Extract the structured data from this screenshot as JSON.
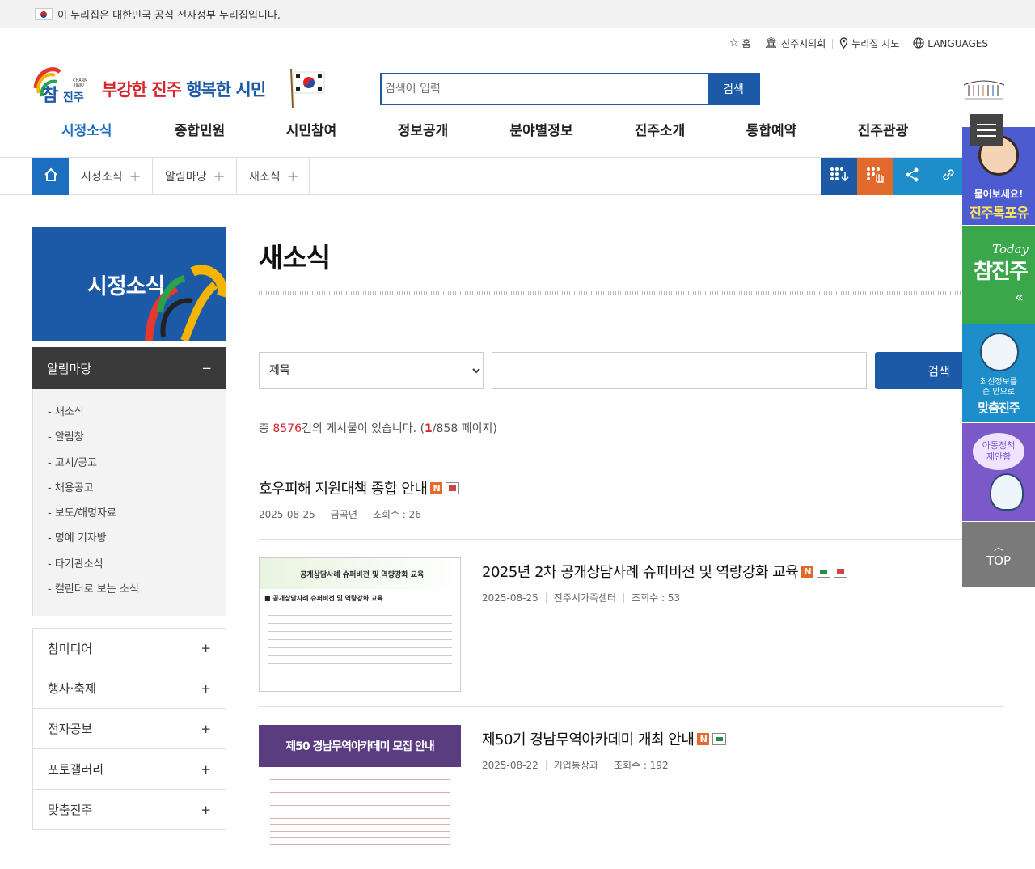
{
  "gov_banner": {
    "text": "이 누리집은 대한민국 공식 전자정부 누리집입니다."
  },
  "util_nav": [
    {
      "label": "홈",
      "icon": "star-icon"
    },
    {
      "label": "진주시의회",
      "icon": "council-icon"
    },
    {
      "label": "누리집 지도",
      "icon": "location-pin-icon"
    },
    {
      "label": "LANGUAGES",
      "icon": "globe-icon"
    }
  ],
  "header": {
    "slogan_red_1": "부강한 진주",
    "slogan_blue": "행복한 시민",
    "search_placeholder": "검색어 입력",
    "search_button": "검색"
  },
  "gnb": [
    "시정소식",
    "종합민원",
    "시민참여",
    "정보공개",
    "분야별정보",
    "진주소개",
    "통합예약",
    "진주관광"
  ],
  "breadcrumb": [
    "시정소식",
    "알림마당",
    "새소식"
  ],
  "side": {
    "title": "시정소식",
    "section": "알림마당",
    "sub_items": [
      "새소식",
      "알림창",
      "고시/공고",
      "채용공고",
      "보도/해명자료",
      "명예 기자방",
      "타기관소식",
      "캘린더로 보는 소식"
    ],
    "menu_items": [
      "참미디어",
      "행사·축제",
      "전자공보",
      "포토갤러리",
      "맞춤진주"
    ]
  },
  "content": {
    "page_title": "새소식",
    "filter_select": "제목",
    "filter_button": "검색",
    "total_prefix": "총 ",
    "total_count": "8576",
    "total_mid": "건의 게시물이 있습니다. (",
    "current_page": "1",
    "total_suffix": "/858 페이지)"
  },
  "posts": [
    {
      "title": "호우피해 지원대책 종합 안내",
      "date": "2025-08-25",
      "dept": "금곡면",
      "views": "조회수 : 26",
      "has_thumb": false
    },
    {
      "title": "2025년 2차 공개상담사례 슈퍼비전 및 역량강화 교육",
      "date": "2025-08-25",
      "dept": "진주시가족센터",
      "views": "조회수 : 53",
      "has_thumb": true,
      "thumb_title": "공개상담사례 슈퍼비전 및 역량강화 교육",
      "thumb_heading": "■ 공개상담사례 슈퍼비전 및 역량강화 교육"
    },
    {
      "title": "제50기 경남무역아카데미 개최 안내",
      "date": "2025-08-22",
      "dept": "기업통상과",
      "views": "조회수 : 192",
      "has_thumb": true,
      "thumb_title": "제50 경남무역아카데미 모집 안내"
    }
  ],
  "quick": {
    "q1_line1": "물어보세요!",
    "q1_line2": "진주톡포유",
    "q2_today": "Today",
    "q2_name": "참진주",
    "q3_line1": "최신정보를",
    "q3_line2": "손 안으로",
    "q3_line3": "맞춤진주",
    "q4_line1": "아동정책",
    "q4_line2": "제안함",
    "top": "TOP"
  },
  "colors": {
    "primary": "#1c5aa8",
    "accent_red": "#d6262b",
    "orange": "#e26a2c",
    "green": "#3aa84a"
  }
}
